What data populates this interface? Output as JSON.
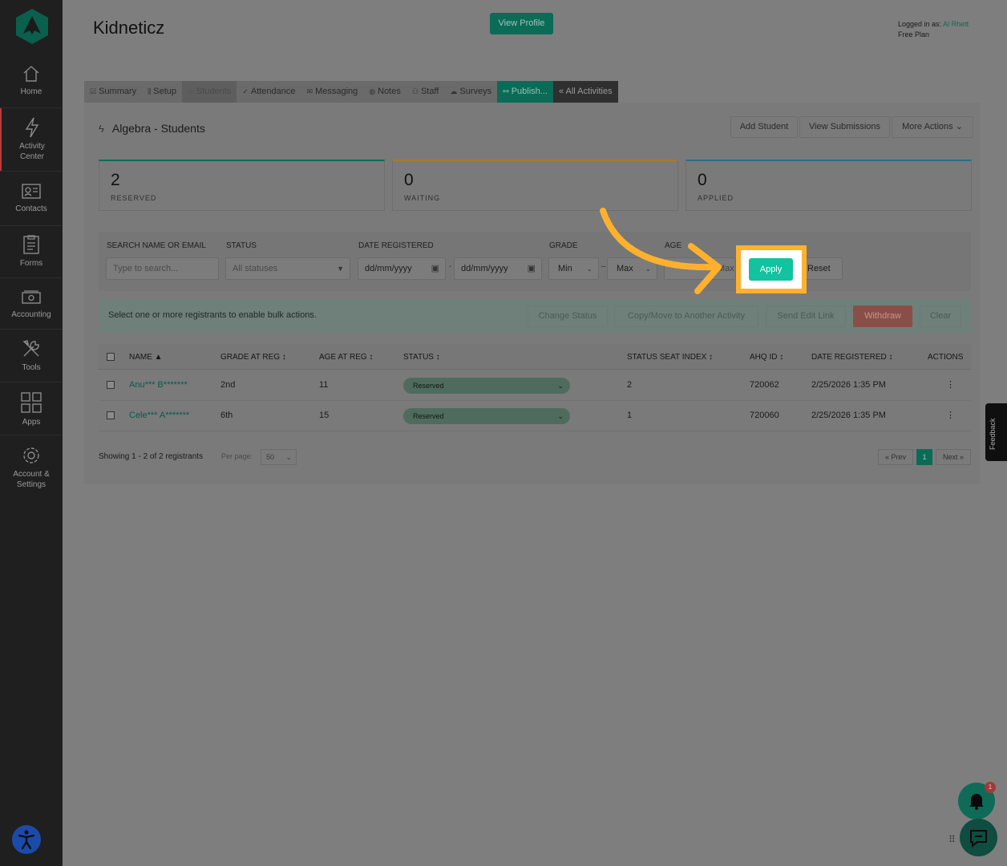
{
  "sidebar": {
    "items": [
      {
        "label": "Home"
      },
      {
        "label": "Activity Center"
      },
      {
        "label": "Contacts"
      },
      {
        "label": "Forms"
      },
      {
        "label": "Accounting"
      },
      {
        "label": "Tools"
      },
      {
        "label": "Apps"
      },
      {
        "label": "Account & Settings"
      }
    ]
  },
  "header": {
    "org_name": "Kidneticz",
    "view_profile": "View Profile",
    "logged_in_prefix": "Logged in as:",
    "logged_in_user": "Al Rhett",
    "plan": "Free Plan"
  },
  "tabs": [
    {
      "label": "Summary"
    },
    {
      "label": "Setup"
    },
    {
      "label": "Students"
    },
    {
      "label": "Attendance"
    },
    {
      "label": "Messaging"
    },
    {
      "label": "Notes"
    },
    {
      "label": "Staff"
    },
    {
      "label": "Surveys"
    },
    {
      "label": "Publish..."
    },
    {
      "label": "« All Activities"
    }
  ],
  "activity": {
    "title": "Algebra - Students",
    "add_student": "Add Student",
    "view_submissions": "View Submissions",
    "more_actions": "More Actions"
  },
  "stats": [
    {
      "value": "2",
      "label": "RESERVED",
      "color": "#0b6b57"
    },
    {
      "value": "0",
      "label": "WAITING",
      "color": "#a87a2a"
    },
    {
      "value": "0",
      "label": "APPLIED",
      "color": "#2a6f8a"
    }
  ],
  "filters": {
    "search_label": "SEARCH NAME OR EMAIL",
    "search_placeholder": "Type to search...",
    "status_label": "STATUS",
    "status_value": "All statuses",
    "date_label": "DATE REGISTERED",
    "date_from": "dd/mm/yyyy",
    "date_to": "dd/mm/yyyy",
    "date_sep": "-",
    "grade_label": "GRADE",
    "grade_min": "Min",
    "grade_max": "Max",
    "grade_sep": "–",
    "age_label": "AGE",
    "age_max": "Max",
    "apply": "Apply",
    "reset": "Reset"
  },
  "bulk": {
    "text": "Select one or more registrants to enable bulk actions.",
    "change_status": "Change Status",
    "copy_move": "Copy/Move to Another Activity",
    "send_edit_link": "Send Edit Link",
    "withdraw": "Withdraw",
    "clear": "Clear"
  },
  "table": {
    "headers": [
      "NAME ▲",
      "GRADE AT REG ↕",
      "AGE AT REG ↕",
      "STATUS ↕",
      "STATUS SEAT INDEX ↕",
      "AHQ ID ↕",
      "DATE REGISTERED ↕",
      "ACTIONS"
    ],
    "rows": [
      {
        "name": "Anu*** B*******",
        "grade": "2nd",
        "age": "11",
        "status": "Reserved",
        "seat": "2",
        "ahq": "720062",
        "date": "2/25/2026 1:35 PM"
      },
      {
        "name": "Cele*** A*******",
        "grade": "6th",
        "age": "15",
        "status": "Reserved",
        "seat": "1",
        "ahq": "720060",
        "date": "2/25/2026 1:35 PM"
      }
    ]
  },
  "pagination": {
    "showing": "Showing 1 - 2 of 2 registrants",
    "per_page_label": "Per page:",
    "per_page_value": "50",
    "prev": "« Prev",
    "current": "1",
    "next": "Next »"
  },
  "feedback": "Feedback",
  "notification_count": "1",
  "colors": {
    "brand": "#13c29e",
    "highlight": "#ffb12e"
  }
}
